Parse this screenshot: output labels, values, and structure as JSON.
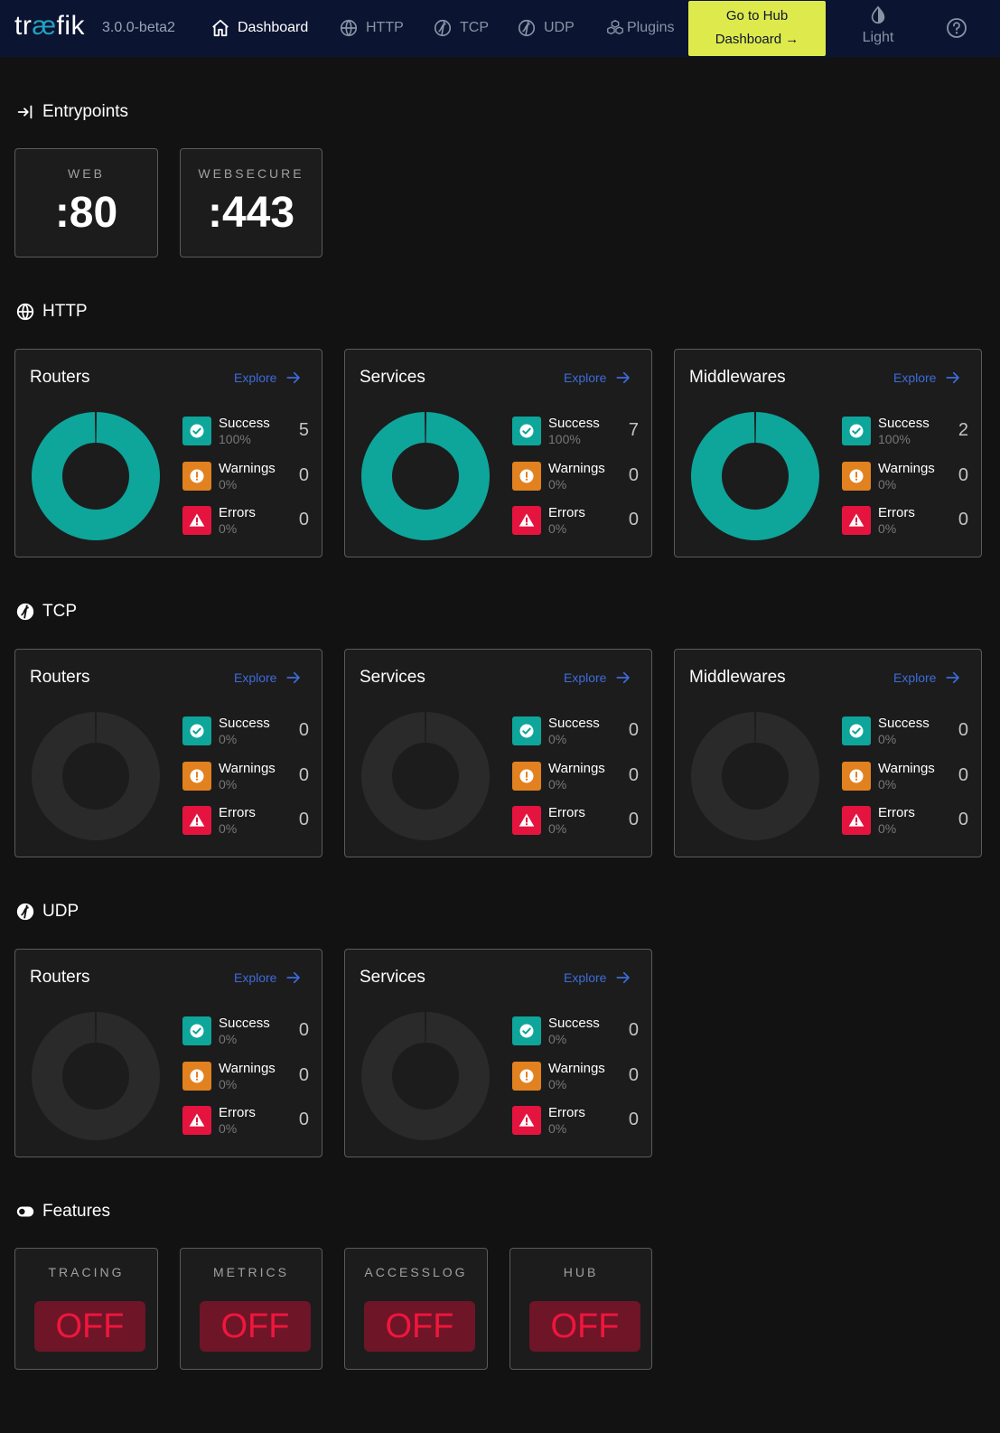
{
  "header": {
    "logo_prefix": "tr",
    "logo_ae": "æ",
    "logo_suffix": "fik",
    "version": "3.0.0-beta2",
    "nav": [
      {
        "label": "Dashboard",
        "icon": "home-icon",
        "active": true
      },
      {
        "label": "HTTP",
        "icon": "globe-icon"
      },
      {
        "label": "TCP",
        "icon": "tcp-icon"
      },
      {
        "label": "UDP",
        "icon": "udp-icon"
      },
      {
        "label": "Plugins",
        "icon": "plugins-icon"
      }
    ],
    "hub_line1": "Go to Hub",
    "hub_line2": "Dashboard →",
    "theme_label": "Light",
    "help_icon": "help-icon"
  },
  "entrypoints": {
    "title": "Entrypoints",
    "items": [
      {
        "name": "WEB",
        "port": ":80"
      },
      {
        "name": "WEBSECURE",
        "port": ":443"
      }
    ]
  },
  "sections": {
    "http": {
      "title": "HTTP",
      "cards": [
        {
          "title": "Routers",
          "explore": "Explore",
          "success": {
            "label": "Success",
            "pct": "100%",
            "count": "5"
          },
          "warnings": {
            "label": "Warnings",
            "pct": "0%",
            "count": "0"
          },
          "errors": {
            "label": "Errors",
            "pct": "0%",
            "count": "0"
          }
        },
        {
          "title": "Services",
          "explore": "Explore",
          "success": {
            "label": "Success",
            "pct": "100%",
            "count": "7"
          },
          "warnings": {
            "label": "Warnings",
            "pct": "0%",
            "count": "0"
          },
          "errors": {
            "label": "Errors",
            "pct": "0%",
            "count": "0"
          }
        },
        {
          "title": "Middlewares",
          "explore": "Explore",
          "success": {
            "label": "Success",
            "pct": "100%",
            "count": "2"
          },
          "warnings": {
            "label": "Warnings",
            "pct": "0%",
            "count": "0"
          },
          "errors": {
            "label": "Errors",
            "pct": "0%",
            "count": "0"
          }
        }
      ]
    },
    "tcp": {
      "title": "TCP",
      "cards": [
        {
          "title": "Routers",
          "explore": "Explore",
          "success": {
            "label": "Success",
            "pct": "0%",
            "count": "0"
          },
          "warnings": {
            "label": "Warnings",
            "pct": "0%",
            "count": "0"
          },
          "errors": {
            "label": "Errors",
            "pct": "0%",
            "count": "0"
          }
        },
        {
          "title": "Services",
          "explore": "Explore",
          "success": {
            "label": "Success",
            "pct": "0%",
            "count": "0"
          },
          "warnings": {
            "label": "Warnings",
            "pct": "0%",
            "count": "0"
          },
          "errors": {
            "label": "Errors",
            "pct": "0%",
            "count": "0"
          }
        },
        {
          "title": "Middlewares",
          "explore": "Explore",
          "success": {
            "label": "Success",
            "pct": "0%",
            "count": "0"
          },
          "warnings": {
            "label": "Warnings",
            "pct": "0%",
            "count": "0"
          },
          "errors": {
            "label": "Errors",
            "pct": "0%",
            "count": "0"
          }
        }
      ]
    },
    "udp": {
      "title": "UDP",
      "cards": [
        {
          "title": "Routers",
          "explore": "Explore",
          "success": {
            "label": "Success",
            "pct": "0%",
            "count": "0"
          },
          "warnings": {
            "label": "Warnings",
            "pct": "0%",
            "count": "0"
          },
          "errors": {
            "label": "Errors",
            "pct": "0%",
            "count": "0"
          }
        },
        {
          "title": "Services",
          "explore": "Explore",
          "success": {
            "label": "Success",
            "pct": "0%",
            "count": "0"
          },
          "warnings": {
            "label": "Warnings",
            "pct": "0%",
            "count": "0"
          },
          "errors": {
            "label": "Errors",
            "pct": "0%",
            "count": "0"
          }
        }
      ]
    }
  },
  "features": {
    "title": "Features",
    "items": [
      {
        "name": "TRACING",
        "status": "OFF"
      },
      {
        "name": "METRICS",
        "status": "OFF"
      },
      {
        "name": "ACCESSLOG",
        "status": "OFF"
      },
      {
        "name": "HUB",
        "status": "OFF"
      }
    ]
  },
  "colors": {
    "success": "#0ea59b",
    "warning": "#e1811f",
    "error": "#e5143f",
    "donut_empty": "#2a2a2a",
    "accent_hub": "#deea4b",
    "link": "#3d6bd9",
    "nav_bg": "#0b1431"
  }
}
